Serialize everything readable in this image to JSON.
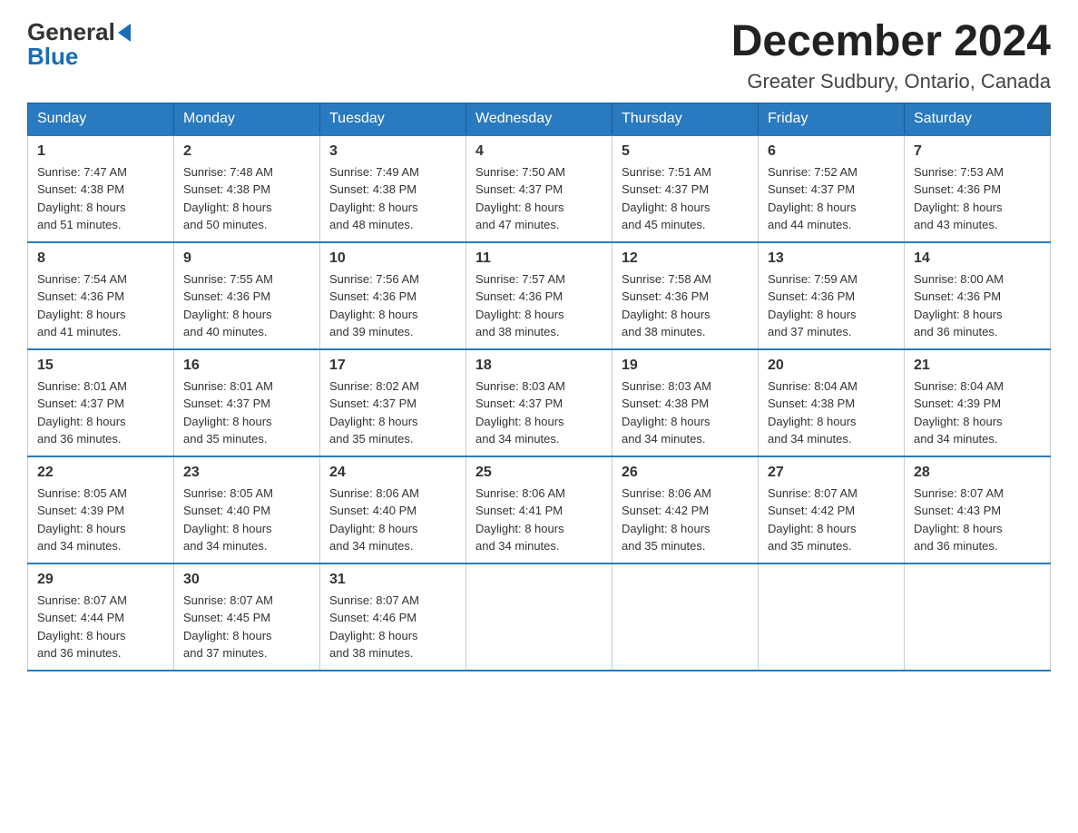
{
  "header": {
    "logo_general": "General",
    "logo_blue": "Blue",
    "month_title": "December 2024",
    "location": "Greater Sudbury, Ontario, Canada"
  },
  "days_of_week": [
    "Sunday",
    "Monday",
    "Tuesday",
    "Wednesday",
    "Thursday",
    "Friday",
    "Saturday"
  ],
  "weeks": [
    [
      {
        "num": "1",
        "sunrise": "7:47 AM",
        "sunset": "4:38 PM",
        "daylight": "8 hours and 51 minutes."
      },
      {
        "num": "2",
        "sunrise": "7:48 AM",
        "sunset": "4:38 PM",
        "daylight": "8 hours and 50 minutes."
      },
      {
        "num": "3",
        "sunrise": "7:49 AM",
        "sunset": "4:38 PM",
        "daylight": "8 hours and 48 minutes."
      },
      {
        "num": "4",
        "sunrise": "7:50 AM",
        "sunset": "4:37 PM",
        "daylight": "8 hours and 47 minutes."
      },
      {
        "num": "5",
        "sunrise": "7:51 AM",
        "sunset": "4:37 PM",
        "daylight": "8 hours and 45 minutes."
      },
      {
        "num": "6",
        "sunrise": "7:52 AM",
        "sunset": "4:37 PM",
        "daylight": "8 hours and 44 minutes."
      },
      {
        "num": "7",
        "sunrise": "7:53 AM",
        "sunset": "4:36 PM",
        "daylight": "8 hours and 43 minutes."
      }
    ],
    [
      {
        "num": "8",
        "sunrise": "7:54 AM",
        "sunset": "4:36 PM",
        "daylight": "8 hours and 41 minutes."
      },
      {
        "num": "9",
        "sunrise": "7:55 AM",
        "sunset": "4:36 PM",
        "daylight": "8 hours and 40 minutes."
      },
      {
        "num": "10",
        "sunrise": "7:56 AM",
        "sunset": "4:36 PM",
        "daylight": "8 hours and 39 minutes."
      },
      {
        "num": "11",
        "sunrise": "7:57 AM",
        "sunset": "4:36 PM",
        "daylight": "8 hours and 38 minutes."
      },
      {
        "num": "12",
        "sunrise": "7:58 AM",
        "sunset": "4:36 PM",
        "daylight": "8 hours and 38 minutes."
      },
      {
        "num": "13",
        "sunrise": "7:59 AM",
        "sunset": "4:36 PM",
        "daylight": "8 hours and 37 minutes."
      },
      {
        "num": "14",
        "sunrise": "8:00 AM",
        "sunset": "4:36 PM",
        "daylight": "8 hours and 36 minutes."
      }
    ],
    [
      {
        "num": "15",
        "sunrise": "8:01 AM",
        "sunset": "4:37 PM",
        "daylight": "8 hours and 36 minutes."
      },
      {
        "num": "16",
        "sunrise": "8:01 AM",
        "sunset": "4:37 PM",
        "daylight": "8 hours and 35 minutes."
      },
      {
        "num": "17",
        "sunrise": "8:02 AM",
        "sunset": "4:37 PM",
        "daylight": "8 hours and 35 minutes."
      },
      {
        "num": "18",
        "sunrise": "8:03 AM",
        "sunset": "4:37 PM",
        "daylight": "8 hours and 34 minutes."
      },
      {
        "num": "19",
        "sunrise": "8:03 AM",
        "sunset": "4:38 PM",
        "daylight": "8 hours and 34 minutes."
      },
      {
        "num": "20",
        "sunrise": "8:04 AM",
        "sunset": "4:38 PM",
        "daylight": "8 hours and 34 minutes."
      },
      {
        "num": "21",
        "sunrise": "8:04 AM",
        "sunset": "4:39 PM",
        "daylight": "8 hours and 34 minutes."
      }
    ],
    [
      {
        "num": "22",
        "sunrise": "8:05 AM",
        "sunset": "4:39 PM",
        "daylight": "8 hours and 34 minutes."
      },
      {
        "num": "23",
        "sunrise": "8:05 AM",
        "sunset": "4:40 PM",
        "daylight": "8 hours and 34 minutes."
      },
      {
        "num": "24",
        "sunrise": "8:06 AM",
        "sunset": "4:40 PM",
        "daylight": "8 hours and 34 minutes."
      },
      {
        "num": "25",
        "sunrise": "8:06 AM",
        "sunset": "4:41 PM",
        "daylight": "8 hours and 34 minutes."
      },
      {
        "num": "26",
        "sunrise": "8:06 AM",
        "sunset": "4:42 PM",
        "daylight": "8 hours and 35 minutes."
      },
      {
        "num": "27",
        "sunrise": "8:07 AM",
        "sunset": "4:42 PM",
        "daylight": "8 hours and 35 minutes."
      },
      {
        "num": "28",
        "sunrise": "8:07 AM",
        "sunset": "4:43 PM",
        "daylight": "8 hours and 36 minutes."
      }
    ],
    [
      {
        "num": "29",
        "sunrise": "8:07 AM",
        "sunset": "4:44 PM",
        "daylight": "8 hours and 36 minutes."
      },
      {
        "num": "30",
        "sunrise": "8:07 AM",
        "sunset": "4:45 PM",
        "daylight": "8 hours and 37 minutes."
      },
      {
        "num": "31",
        "sunrise": "8:07 AM",
        "sunset": "4:46 PM",
        "daylight": "8 hours and 38 minutes."
      },
      null,
      null,
      null,
      null
    ]
  ],
  "labels": {
    "sunrise": "Sunrise:",
    "sunset": "Sunset:",
    "daylight": "Daylight:"
  }
}
